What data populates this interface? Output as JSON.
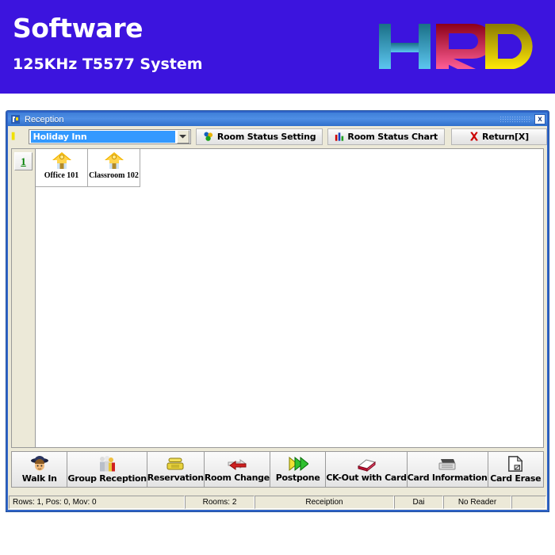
{
  "banner": {
    "title": "Software",
    "subtitle": "125KHz T5577 System",
    "background_color": "#3c14de",
    "logo_text": "HRD",
    "logo_colors": {
      "h_from": "#1a6f86",
      "h_to": "#5cc6f0",
      "r_from": "#8c0018",
      "r_to": "#ff5f96",
      "d_from": "#8a7a00",
      "d_to": "#ffe808"
    }
  },
  "window": {
    "title": "Reception",
    "title_icon": "app-icon",
    "close_label": "x",
    "titlebar_color": "#4f8ee4"
  },
  "toolbar": {
    "marker_icon": "bookmark-icon",
    "combo": {
      "value": "Holiday Inn",
      "arrow_icon": "chevron-down-icon"
    },
    "buttons": [
      {
        "label": "Room Status Setting",
        "icon": "color-circles-icon"
      },
      {
        "label": "Room Status Chart",
        "icon": "bar-chart-icon"
      },
      {
        "label": "Return[X]",
        "icon": "red-x-icon"
      }
    ]
  },
  "sidebar": {
    "tabs": [
      {
        "label": "1"
      }
    ]
  },
  "rooms": [
    {
      "name": "Office 101",
      "icon": "house-icon"
    },
    {
      "name": "Classroom 102",
      "icon": "house-icon"
    }
  ],
  "commands": [
    {
      "label": "Walk In",
      "icon": "person-hat-icon"
    },
    {
      "label": "Group Reception",
      "icon": "group-people-icon"
    },
    {
      "label": "Reservation",
      "icon": "telephone-icon"
    },
    {
      "label": "Room Change",
      "icon": "swap-arrows-icon"
    },
    {
      "label": "Postpone",
      "icon": "fast-forward-icon"
    },
    {
      "label": "CK-Out with Card",
      "icon": "card-out-icon"
    },
    {
      "label": "Card Information",
      "icon": "card-info-icon"
    },
    {
      "label": "Card Erase",
      "icon": "page-erase-icon"
    }
  ],
  "statusbar": {
    "rows_info": "Rows: 1, Pos: 0, Mov: 0",
    "rooms": "Rooms:  2",
    "module": "Receiption",
    "user": "Dai",
    "reader": "No Reader",
    "spare": ""
  }
}
